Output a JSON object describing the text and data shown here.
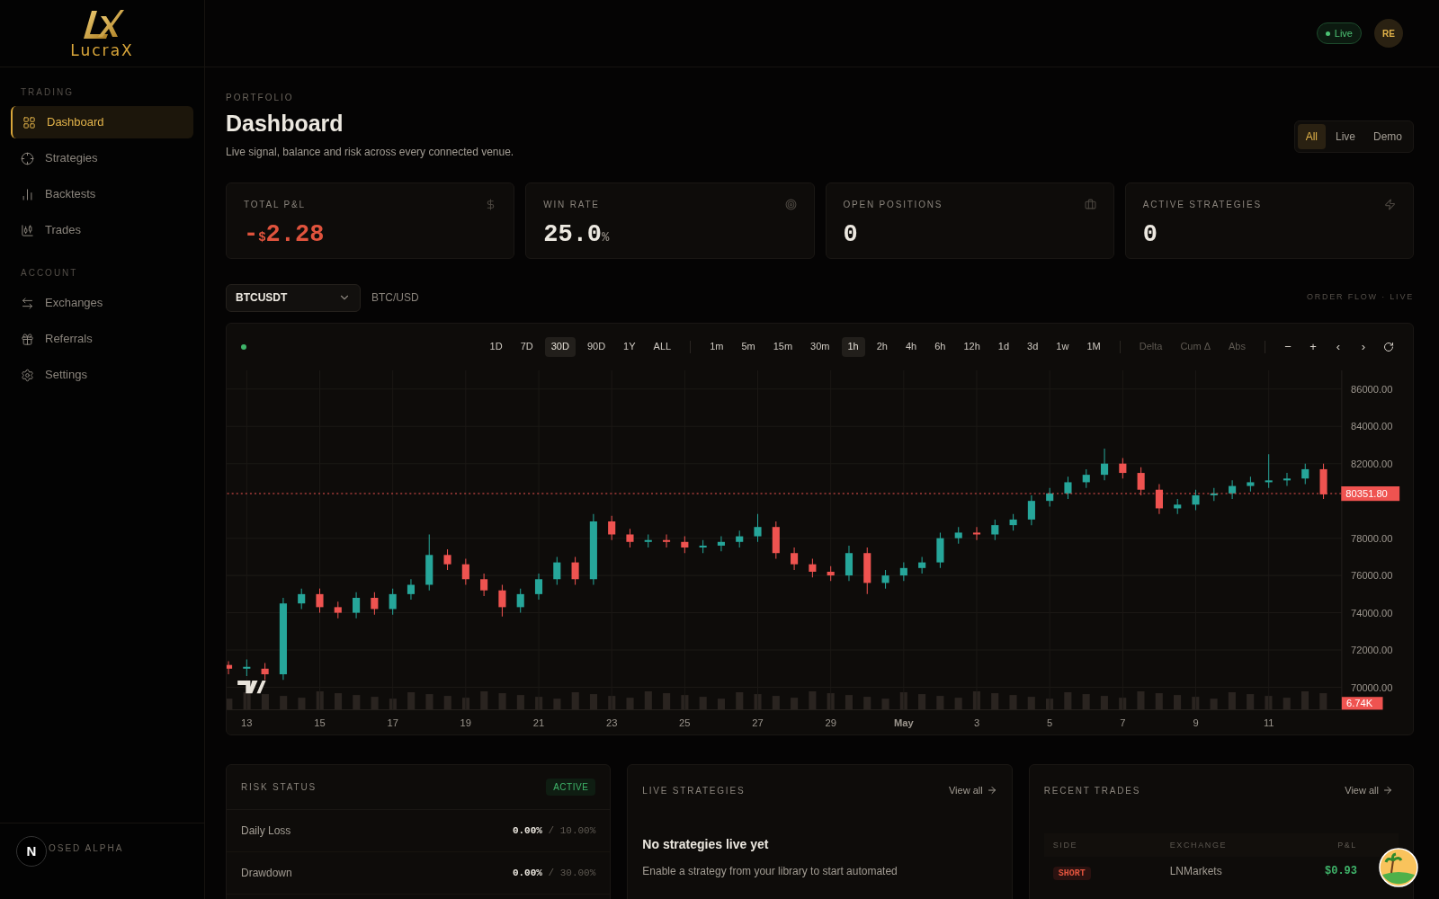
{
  "brand": {
    "name": "LucraX"
  },
  "header": {
    "status": {
      "label": "Live",
      "on": true
    },
    "avatar": "RE"
  },
  "sidebar": {
    "sections": [
      {
        "title": "TRADING",
        "items": [
          {
            "label": "Dashboard",
            "selected": true
          },
          {
            "label": "Strategies",
            "selected": false
          },
          {
            "label": "Backtests",
            "selected": false
          },
          {
            "label": "Trades",
            "selected": false
          }
        ]
      },
      {
        "title": "ACCOUNT",
        "items": [
          {
            "label": "Exchanges",
            "selected": false
          },
          {
            "label": "Referrals",
            "selected": false
          },
          {
            "label": "Settings",
            "selected": false
          }
        ]
      }
    ],
    "footer": {
      "label": "OSED ALPHA",
      "badge": "N"
    }
  },
  "page": {
    "eyebrow": "PORTFOLIO",
    "title": "Dashboard",
    "subtitle": "Live signal, balance and risk across every connected venue.",
    "modes": [
      {
        "label": "All",
        "selected": true
      },
      {
        "label": "Live",
        "selected": false
      },
      {
        "label": "Demo",
        "selected": false
      }
    ]
  },
  "kpis": [
    {
      "label": "TOTAL P&L",
      "sign": "-",
      "currency": "$",
      "value": "2.28"
    },
    {
      "label": "WIN RATE",
      "value": "25.0",
      "suffix": "%"
    },
    {
      "label": "OPEN POSITIONS",
      "value": "0"
    },
    {
      "label": "ACTIVE STRATEGIES",
      "value": "0"
    }
  ],
  "market": {
    "symbol": "BTCUSDT",
    "pair": "BTC/USD",
    "feed": "ORDER FLOW · LIVE"
  },
  "chart": {
    "connected": true,
    "ranges": [
      {
        "label": "1D",
        "selected": false
      },
      {
        "label": "7D",
        "selected": false
      },
      {
        "label": "30D",
        "selected": true
      },
      {
        "label": "90D",
        "selected": false
      },
      {
        "label": "1Y",
        "selected": false
      },
      {
        "label": "ALL",
        "selected": false
      }
    ],
    "intervals": [
      {
        "label": "1m",
        "selected": false
      },
      {
        "label": "5m",
        "selected": false
      },
      {
        "label": "15m",
        "selected": false
      },
      {
        "label": "30m",
        "selected": false
      },
      {
        "label": "1h",
        "selected": true
      },
      {
        "label": "2h",
        "selected": false
      },
      {
        "label": "4h",
        "selected": false
      },
      {
        "label": "6h",
        "selected": false
      },
      {
        "label": "12h",
        "selected": false
      },
      {
        "label": "1d",
        "selected": false
      },
      {
        "label": "3d",
        "selected": false
      },
      {
        "label": "1w",
        "selected": false
      },
      {
        "label": "1M",
        "selected": false
      }
    ],
    "views": [
      {
        "label": "Delta",
        "selected": false
      },
      {
        "label": "Cum Δ",
        "selected": false
      },
      {
        "label": "Abs",
        "selected": false
      }
    ],
    "controls": [
      "−",
      "+",
      "‹",
      "›"
    ],
    "volume": "6.74K",
    "last_price": "80351.80",
    "chart_data": {
      "type": "candlestick",
      "categories": [
        null,
        "13",
        null,
        null,
        null,
        "15",
        null,
        null,
        null,
        "17",
        null,
        null,
        null,
        "19",
        null,
        null,
        null,
        "21",
        null,
        null,
        null,
        "23",
        null,
        null,
        null,
        "25",
        null,
        null,
        null,
        "27",
        null,
        null,
        null,
        "29",
        null,
        null,
        null,
        "May",
        null,
        null,
        null,
        "3",
        null,
        null,
        null,
        "5",
        null,
        null,
        null,
        "7",
        null,
        null,
        null,
        "9",
        null,
        null,
        null,
        "11",
        null,
        null,
        null
      ],
      "ohlc": [
        [
          71200,
          71400,
          70700,
          71000
        ],
        [
          71000,
          71500,
          70600,
          71100
        ],
        [
          71000,
          71300,
          70400,
          70700
        ],
        [
          70700,
          74800,
          70400,
          74500
        ],
        [
          74500,
          75300,
          74200,
          75000
        ],
        [
          75000,
          75300,
          74000,
          74300
        ],
        [
          74300,
          74600,
          73700,
          74000
        ],
        [
          74000,
          75100,
          73700,
          74800
        ],
        [
          74800,
          75100,
          73900,
          74200
        ],
        [
          74200,
          75300,
          73900,
          75000
        ],
        [
          75000,
          75800,
          74700,
          75500
        ],
        [
          75500,
          78200,
          75200,
          77100
        ],
        [
          77100,
          77400,
          76300,
          76600
        ],
        [
          76600,
          76900,
          75500,
          75800
        ],
        [
          75800,
          76100,
          74900,
          75200
        ],
        [
          75200,
          75500,
          73800,
          74300
        ],
        [
          74300,
          75300,
          74000,
          75000
        ],
        [
          75000,
          76100,
          74700,
          75800
        ],
        [
          75800,
          77000,
          75500,
          76700
        ],
        [
          76700,
          77000,
          75500,
          75800
        ],
        [
          75800,
          79300,
          75500,
          78900
        ],
        [
          78900,
          79200,
          77900,
          78200
        ],
        [
          78200,
          78500,
          77500,
          77800
        ],
        [
          77800,
          78200,
          77500,
          77900
        ],
        [
          77900,
          78200,
          77500,
          77800
        ],
        [
          77800,
          78100,
          77200,
          77500
        ],
        [
          77500,
          77900,
          77200,
          77600
        ],
        [
          77600,
          78100,
          77300,
          77800
        ],
        [
          77800,
          78400,
          77500,
          78100
        ],
        [
          78100,
          79300,
          77800,
          78600
        ],
        [
          78600,
          78900,
          76900,
          77200
        ],
        [
          77200,
          77500,
          76300,
          76600
        ],
        [
          76600,
          76900,
          75900,
          76200
        ],
        [
          76200,
          76500,
          75700,
          76000
        ],
        [
          76000,
          77600,
          75700,
          77200
        ],
        [
          77200,
          77500,
          75000,
          75600
        ],
        [
          75600,
          76300,
          75300,
          76000
        ],
        [
          76000,
          76700,
          75700,
          76400
        ],
        [
          76400,
          77000,
          76100,
          76700
        ],
        [
          76700,
          78300,
          76400,
          78000
        ],
        [
          78000,
          78600,
          77700,
          78300
        ],
        [
          78300,
          78600,
          77900,
          78200
        ],
        [
          78200,
          79000,
          77900,
          78700
        ],
        [
          78700,
          79300,
          78400,
          79000
        ],
        [
          79000,
          80300,
          78700,
          80000
        ],
        [
          80000,
          80700,
          79700,
          80400
        ],
        [
          80400,
          81300,
          80100,
          81000
        ],
        [
          81000,
          81700,
          80700,
          81400
        ],
        [
          81400,
          82800,
          81100,
          82000
        ],
        [
          82000,
          82300,
          81200,
          81500
        ],
        [
          81500,
          81800,
          80300,
          80600
        ],
        [
          80600,
          80900,
          79300,
          79600
        ],
        [
          79600,
          80100,
          79300,
          79800
        ],
        [
          79800,
          80600,
          79500,
          80300
        ],
        [
          80300,
          80700,
          80000,
          80400
        ],
        [
          80400,
          81100,
          80100,
          80800
        ],
        [
          80800,
          81300,
          80500,
          81000
        ],
        [
          81000,
          82500,
          80700,
          81100
        ],
        [
          81100,
          81500,
          80800,
          81200
        ],
        [
          81200,
          82000,
          80900,
          81700
        ],
        [
          81700,
          82000,
          80100,
          80350
        ]
      ],
      "grid": true,
      "ylim": [
        68800,
        87000
      ],
      "yticks": [
        {
          "value": 70000,
          "label": "70000.00"
        },
        {
          "value": 72000,
          "label": "72000.00"
        },
        {
          "value": 74000,
          "label": "74000.00"
        },
        {
          "value": 76000,
          "label": "76000.00"
        },
        {
          "value": 78000,
          "label": "78000.00"
        },
        {
          "value": 82000,
          "label": "82000.00"
        },
        {
          "value": 84000,
          "label": "84000.00"
        },
        {
          "value": 86000,
          "label": "86000.00"
        }
      ]
    }
  },
  "risk": {
    "title": "RISK STATUS",
    "badge": "ACTIVE",
    "rows": [
      {
        "label": "Daily Loss",
        "value": "0.00%",
        "limit": "/ 10.00%"
      },
      {
        "label": "Drawdown",
        "value": "0.00%",
        "limit": "/ 30.00%"
      }
    ]
  },
  "live_strategies": {
    "title": "LIVE STRATEGIES",
    "link": "View all",
    "empty_title": "No strategies live yet",
    "empty_text": "Enable a strategy from your library to start automated"
  },
  "recent_trades": {
    "title": "RECENT TRADES",
    "link": "View all",
    "columns": [
      "SIDE",
      "EXCHANGE",
      "P&L"
    ],
    "rows": [
      {
        "side": "SHORT",
        "exchange": "LNMarkets",
        "pnl": "$0.93"
      }
    ]
  }
}
